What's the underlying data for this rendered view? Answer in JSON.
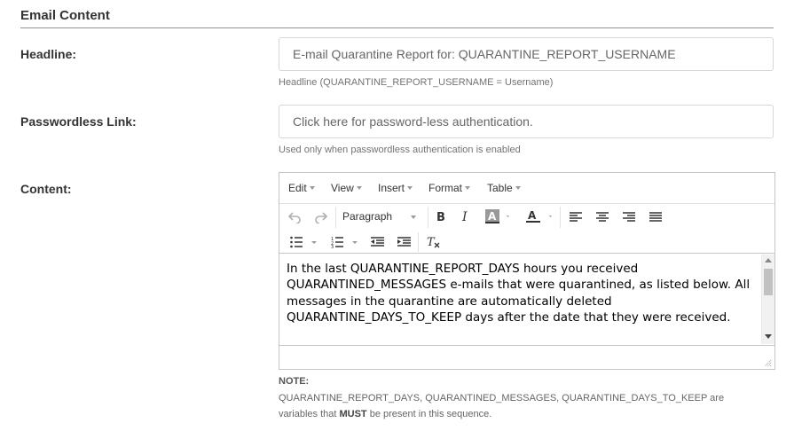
{
  "section": {
    "title": "Email Content"
  },
  "headline": {
    "label": "Headline:",
    "value": "E-mail Quarantine Report for: QUARANTINE_REPORT_USERNAME",
    "help": "Headline (QUARANTINE_REPORT_USERNAME = Username)"
  },
  "passwordless": {
    "label": "Passwordless Link:",
    "value": "Click here for password-less authentication.",
    "help": "Used only when passwordless authentication is enabled"
  },
  "content": {
    "label": "Content:",
    "menu": {
      "edit": "Edit",
      "view": "View",
      "insert": "Insert",
      "format": "Format",
      "table": "Table"
    },
    "block_format": "Paragraph",
    "text": "In the last QUARANTINE_REPORT_DAYS hours you received QUARANTINED_MESSAGES e-mails that were quarantined, as listed below. All messages in the quarantine are automatically deleted QUARANTINE_DAYS_TO_KEEP days after the date that they were received."
  },
  "note": {
    "label": "NOTE:",
    "line1": "QUARANTINE_REPORT_DAYS, QUARANTINED_MESSAGES, QUARANTINE_DAYS_TO_KEEP are",
    "prefix": "variables that ",
    "must": "MUST",
    "suffix": " be present in this sequence."
  }
}
